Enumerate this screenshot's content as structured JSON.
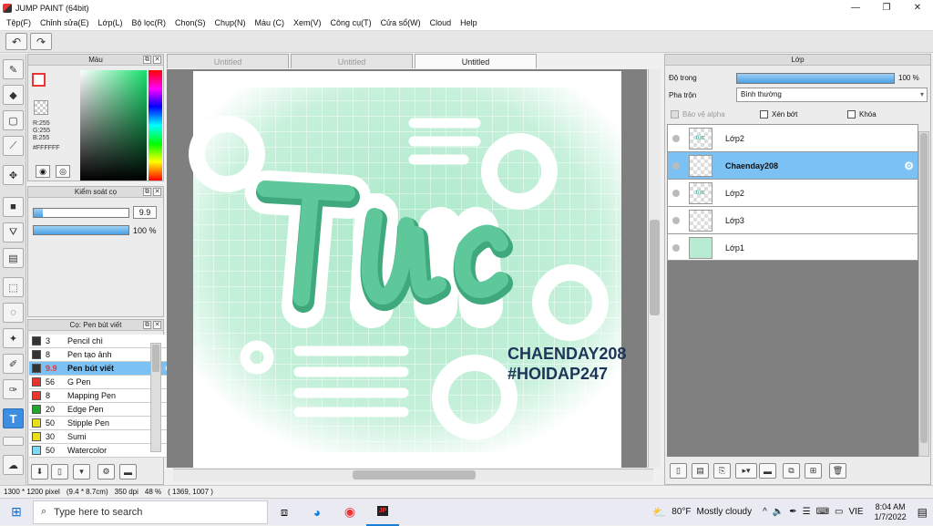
{
  "window": {
    "title": "JUMP PAINT (64bit)",
    "minimize": "—",
    "restore": "❐",
    "close": "✕"
  },
  "menu": [
    "Tệp(F)",
    "Chỉnh sửa(E)",
    "Lớp(L)",
    "Bộ lọc(R)",
    "Chọn(S)",
    "Chụp(N)",
    "Màu (C)",
    "Xem(V)",
    "Công cụ(T)",
    "Cửa sổ(W)",
    "Cloud",
    "Help"
  ],
  "color_panel": {
    "title": "Màu",
    "r": "R:255",
    "g": "G:255",
    "b": "B:255",
    "hex": "#FFFFFF"
  },
  "brush_control": {
    "title": "Kiểm soát cọ",
    "size_value": "9.9",
    "opacity_value": "100 %",
    "size_level": 0.1,
    "opacity_level": 1.0
  },
  "brush_list": {
    "title": "Cọ: Pen bút viết",
    "items": [
      {
        "size": "3",
        "name": "Pencil chì",
        "color": "#333333"
      },
      {
        "size": "8",
        "name": "Pen tạo ảnh",
        "color": "#333333"
      },
      {
        "size": "9.9",
        "name": "Pen bút viết",
        "color": "#333333",
        "selected": true
      },
      {
        "size": "56",
        "name": "G Pen",
        "color": "#e8342d"
      },
      {
        "size": "8",
        "name": "Mapping Pen",
        "color": "#e8342d"
      },
      {
        "size": "20",
        "name": "Edge Pen",
        "color": "#22a52b"
      },
      {
        "size": "50",
        "name": "Stipple Pen",
        "color": "#e8e01a"
      },
      {
        "size": "30",
        "name": "Sumi",
        "color": "#e8e01a"
      },
      {
        "size": "50",
        "name": "Watercolor",
        "color": "#7fd9f5"
      }
    ]
  },
  "tabs": [
    "Untitled",
    "Untitled",
    "Untitled"
  ],
  "artwork": {
    "line1": "CHAENDAY208",
    "line2": "#HOIDAP247"
  },
  "layers_panel": {
    "title": "Lớp",
    "opacity_label": "Độ trong",
    "opacity_value": "100 %",
    "opacity_level": 1.0,
    "blend_label": "Pha trộn",
    "blend_value": "Bình thường",
    "protect_alpha": "Bảo vệ alpha",
    "clip": "Xén bớt",
    "lock": "Khóa",
    "layers": [
      {
        "name": "Lớp2",
        "thumb": "tức"
      },
      {
        "name": "Chaenday208",
        "thumb": "",
        "selected": true
      },
      {
        "name": "Lớp2",
        "thumb": "tức"
      },
      {
        "name": "Lớp3",
        "thumb": ""
      },
      {
        "name": "Lớp1",
        "thumb": ""
      }
    ]
  },
  "status": {
    "size": "1300 * 1200 pixel",
    "cm": "(9.4 * 8.7cm)",
    "dpi": "350 dpi",
    "zoom": "48 %",
    "coords": "( 1369, 1007 )"
  },
  "taskbar": {
    "search_placeholder": "Type here to search",
    "weather_temp": "80°F",
    "weather_text": "Mostly cloudy",
    "lang": "VIE",
    "time": "8:04 AM",
    "date": "1/7/2022"
  },
  "colors": {
    "accent": "#3d8de0",
    "selection": "#7cc1f4",
    "mint": "#5ec89a",
    "navy": "#1d3557"
  }
}
